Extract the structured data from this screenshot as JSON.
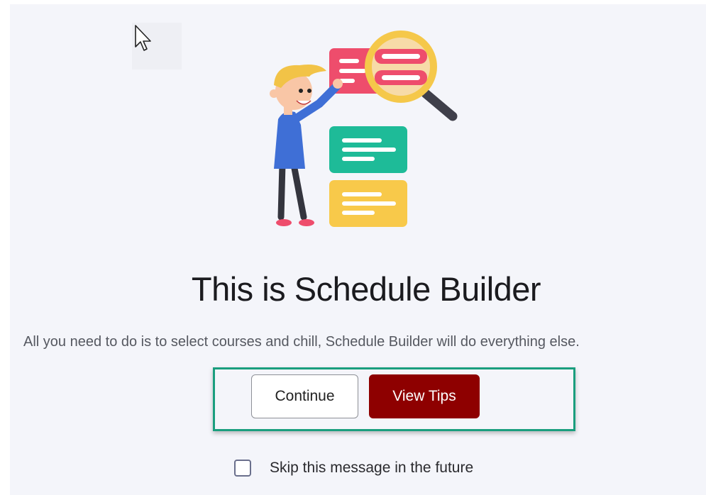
{
  "dialog": {
    "title": "This is Schedule Builder",
    "subtitle": "All you need to do is to select courses and chill, Schedule Builder will do everything else.",
    "continue_label": "Continue",
    "view_tips_label": "View Tips",
    "skip_label": "Skip this message in the future",
    "skip_checked": false,
    "illustration_icon": "person-with-magnifier-and-cards-illustration",
    "cursor_icon": "mouse-pointer-icon"
  },
  "colors": {
    "background": "#f4f5fa",
    "primary_button": "#8e0000",
    "highlight_border": "#1a9e7e",
    "title_text": "#1b1b1f",
    "subtitle_text": "#555860"
  }
}
